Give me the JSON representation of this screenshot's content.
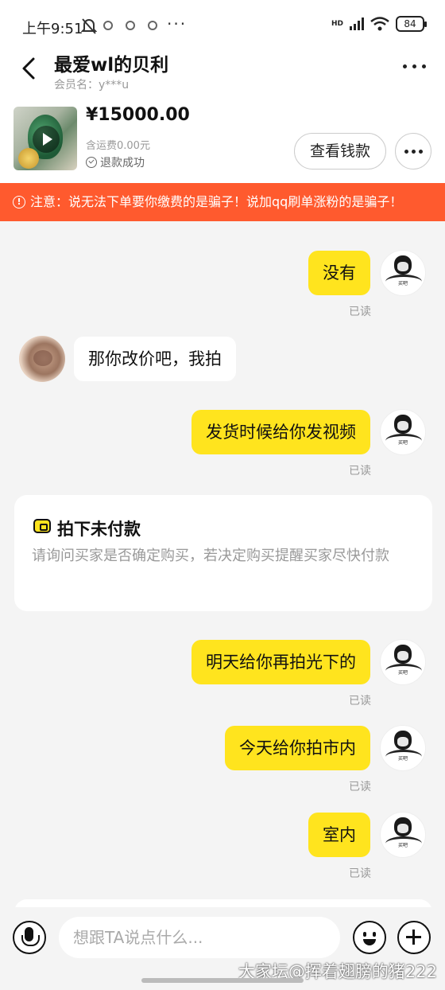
{
  "status_bar": {
    "time": "上午9:51",
    "network_label": "HD",
    "battery": "84",
    "more": "···"
  },
  "header": {
    "name": "最爱wl的贝利",
    "member_label": "会员名：y***u"
  },
  "product": {
    "price": "¥15000.00",
    "shipping": "含运费0.00元",
    "status": "退款成功",
    "view_payment_button": "查看钱款"
  },
  "warning": {
    "text": "注意：说无法下单要你缴费的是骗子！说加qq刷单涨粉的是骗子！"
  },
  "messages": [
    {
      "from": "me",
      "text": "没有",
      "status": "已读"
    },
    {
      "from": "them",
      "text": "那你改价吧，我拍"
    },
    {
      "from": "me",
      "text": "发货时候给你发视频",
      "status": "已读"
    },
    {
      "from": "me",
      "text": "明天给你再拍光下的",
      "status": "已读"
    },
    {
      "from": "me",
      "text": "今天给你拍市内",
      "status": "已读"
    },
    {
      "from": "me",
      "text": "室内",
      "status": "已读"
    }
  ],
  "system_card": {
    "title": "拍下未付款",
    "body": "请询问买家是否确定购买，若决定购买提醒买家尽快付款"
  },
  "avatar_me_caption": "买吧",
  "input": {
    "placeholder": "想跟TA说点什么..."
  },
  "watermark": "大家坛@挥着翅膀的猪222",
  "colors": {
    "accent_yellow": "#ffe41e",
    "warning_red": "#ff5a2e",
    "background": "#f4f4f4"
  },
  "icons": [
    "back-arrow-icon",
    "more-dots-icon",
    "play-icon",
    "check-circle-icon",
    "warning-icon",
    "wallet-icon",
    "microphone-icon",
    "emoji-icon",
    "plus-icon"
  ]
}
